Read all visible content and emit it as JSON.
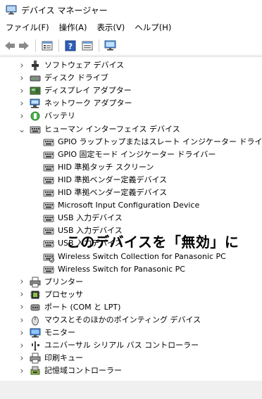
{
  "window": {
    "title": "デバイス マネージャー",
    "icon": "device-manager-icon"
  },
  "menu": [
    "ファイル(F)",
    "操作(A)",
    "表示(V)",
    "ヘルプ(H)"
  ],
  "toolbar": [
    "back-arrow-icon",
    "forward-arrow-icon",
    "properties-icon",
    "help-icon",
    "show-hidden-icon",
    "monitor-scan-icon"
  ],
  "tree": [
    {
      "label": "ソフトウェア デバイス",
      "icon": "software-device-icon",
      "expanded": false
    },
    {
      "label": "ディスク ドライブ",
      "icon": "disk-drive-icon",
      "expanded": false
    },
    {
      "label": "ディスプレイ アダプター",
      "icon": "display-adapter-icon",
      "expanded": false
    },
    {
      "label": "ネットワーク アダプター",
      "icon": "network-adapter-icon",
      "expanded": false
    },
    {
      "label": "バッテリ",
      "icon": "battery-icon",
      "expanded": false
    },
    {
      "label": "ヒューマン インターフェイス デバイス",
      "icon": "hid-icon",
      "expanded": true,
      "children": [
        "GPIO ラップトップまたはスレート インジケーター ドライバー",
        "GPIO 固定モード インジケーター ドライバー",
        "HID 準拠タッチ スクリーン",
        "HID 準拠ベンダー定義デバイス",
        "HID 準拠ベンダー定義デバイス",
        "Microsoft Input Configuration Device",
        "USB 入力デバイス",
        "USB 入力デバイス",
        "USB 入力デバイス",
        "Wireless Switch Collection for Panasonic PC",
        "Wireless Switch for Panasonic PC"
      ]
    },
    {
      "label": "プリンター",
      "icon": "printer-icon",
      "expanded": false
    },
    {
      "label": "プロセッサ",
      "icon": "processor-icon",
      "expanded": false
    },
    {
      "label": "ポート (COM と LPT)",
      "icon": "port-icon",
      "expanded": false
    },
    {
      "label": "マウスとそのほかのポインティング デバイス",
      "icon": "mouse-icon",
      "expanded": false
    },
    {
      "label": "モニター",
      "icon": "monitor-icon",
      "expanded": false
    },
    {
      "label": "ユニバーサル シリアル バス コントローラー",
      "icon": "usb-controller-icon",
      "expanded": false
    },
    {
      "label": "印刷キュー",
      "icon": "print-queue-icon",
      "expanded": false
    },
    {
      "label": "記憶域コントローラー",
      "icon": "storage-controller-icon",
      "expanded": false
    }
  ],
  "annotation": "このデバイスを「無効」に"
}
